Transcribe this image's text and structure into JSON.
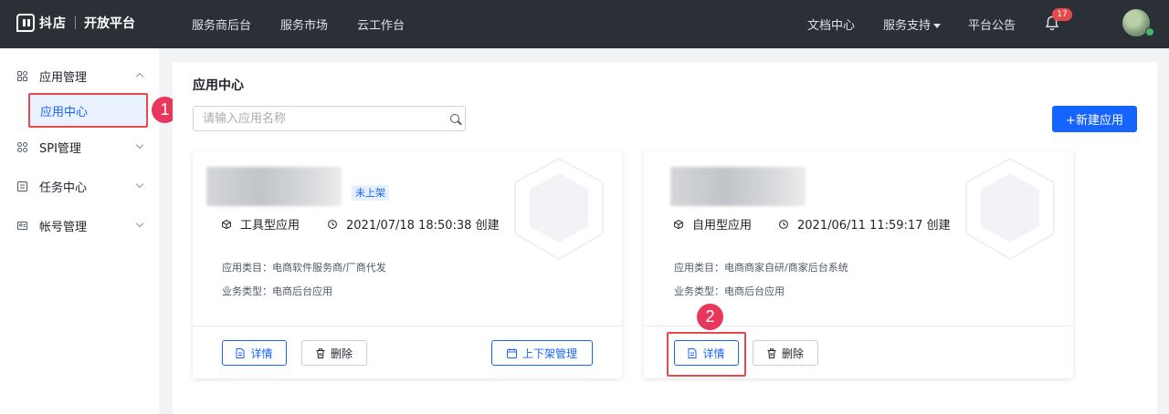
{
  "header": {
    "brand": "抖店",
    "brand_sub": "开放平台",
    "nav": [
      "服务商后台",
      "服务市场",
      "云工作台"
    ],
    "right_links": {
      "docs": "文档中心",
      "support": "服务支持",
      "announcements": "平台公告"
    },
    "notification_count": "17"
  },
  "sidebar": {
    "groups": [
      {
        "label": "应用管理",
        "icon": "app-grid-icon",
        "expanded": true
      },
      {
        "label": "SPI管理",
        "icon": "spi-icon",
        "expanded": false
      },
      {
        "label": "任务中心",
        "icon": "task-icon",
        "expanded": false
      },
      {
        "label": "帐号管理",
        "icon": "account-icon",
        "expanded": false
      }
    ],
    "active_sub_item": "应用中心"
  },
  "annotations": {
    "marker_1": "1",
    "marker_2": "2",
    "color": "#e5484d"
  },
  "main": {
    "title": "应用中心",
    "search_placeholder": "请输入应用名称",
    "new_button": "+新建应用",
    "accent_color": "#1664ff",
    "cards": [
      {
        "status": "未上架",
        "app_type": "工具型应用",
        "created": "2021/07/18 18:50:38 创建",
        "category": "应用类目：电商软件服务商/厂商代发",
        "business_type": "业务类型：电商后台应用",
        "buttons": [
          "详情",
          "删除",
          "上下架管理"
        ]
      },
      {
        "app_type": "自用型应用",
        "created": "2021/06/11 11:59:17 创建",
        "category": "应用类目：电商商家自研/商家后台系统",
        "business_type": "业务类型：电商后台应用",
        "buttons": [
          "详情",
          "删除"
        ]
      }
    ]
  }
}
